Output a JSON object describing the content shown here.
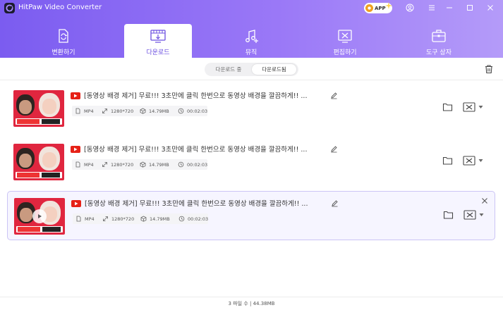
{
  "app": {
    "title": "HitPaw Video Converter",
    "badge": "APP"
  },
  "tabs": [
    {
      "label": "변환하기",
      "icon": "convert-file-icon"
    },
    {
      "label": "다운로드",
      "icon": "film-download-icon"
    },
    {
      "label": "뮤직",
      "icon": "music-add-icon"
    },
    {
      "label": "편집하기",
      "icon": "edit-video-icon"
    },
    {
      "label": "도구 상자",
      "icon": "toolbox-icon"
    }
  ],
  "segment": {
    "downloading": "다운로드 중",
    "downloaded": "다운로드됨"
  },
  "items": [
    {
      "title": "[동영상 배경 제거] 무료!!! 3초만에 클릭 한번으로 동영상 배경을 깔끔하게!!   ...",
      "format": "MP4",
      "resolution": "1280*720",
      "size": "14.79MB",
      "duration": "00:02:03"
    },
    {
      "title": "[동영상 배경 제거] 무료!!! 3초만에 클릭 한번으로 동영상 배경을 깔끔하게!!   ...",
      "format": "MP4",
      "resolution": "1280*720",
      "size": "14.79MB",
      "duration": "00:02:03"
    },
    {
      "title": "[동영상 배경 제거] 무료!!! 3초만에 클릭 한번으로 동영상 배경을 깔끔하게!!   ...",
      "format": "MP4",
      "resolution": "1280*720",
      "size": "14.79MB",
      "duration": "00:02:03"
    }
  ],
  "footer": {
    "summary": "3 파일 수 | 44.38MB"
  },
  "colors": {
    "accent": "#7b5cf0",
    "youtube": "#e62117"
  }
}
